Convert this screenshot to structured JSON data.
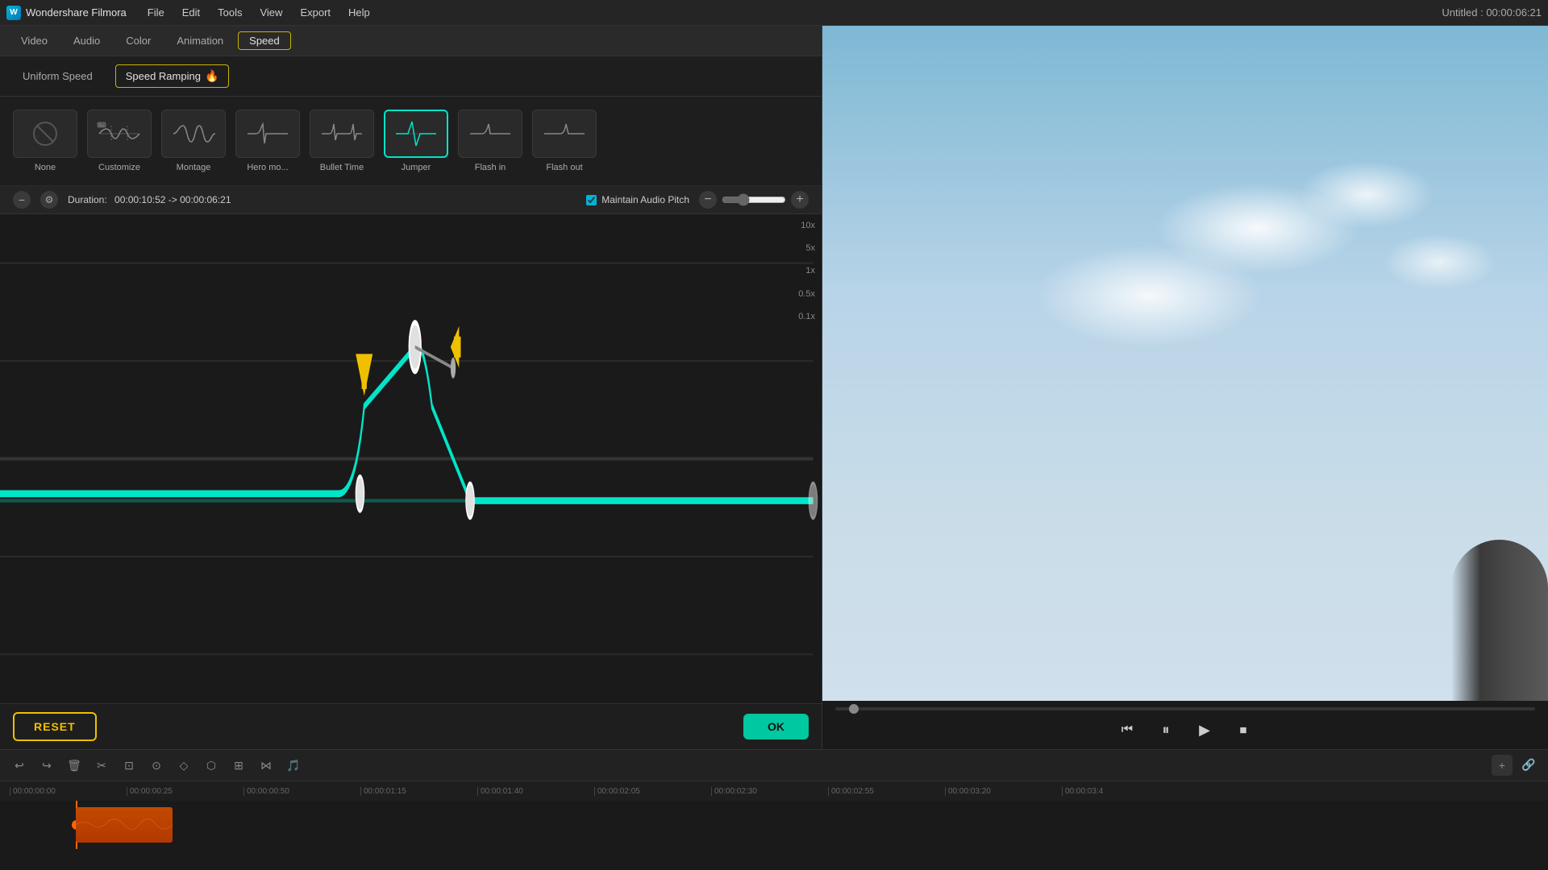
{
  "app": {
    "name": "Wondershare Filmora",
    "title": "Untitled : 00:00:06:21"
  },
  "menubar": {
    "items": [
      "File",
      "Edit",
      "Tools",
      "View",
      "Export",
      "Help"
    ]
  },
  "prop_tabs": {
    "items": [
      "Video",
      "Audio",
      "Color",
      "Animation",
      "Speed"
    ],
    "active": "Speed"
  },
  "speed_tabs": {
    "uniform": "Uniform Speed",
    "ramping": "Speed Ramping",
    "active": "Speed Ramping"
  },
  "presets": [
    {
      "id": "none",
      "label": "None",
      "selected": false
    },
    {
      "id": "customize",
      "label": "Customize",
      "selected": false
    },
    {
      "id": "montage",
      "label": "Montage",
      "selected": false
    },
    {
      "id": "hero-mo",
      "label": "Hero mo...",
      "selected": false
    },
    {
      "id": "bullet-time",
      "label": "Bullet Time",
      "selected": false
    },
    {
      "id": "jumper",
      "label": "Jumper",
      "selected": true
    },
    {
      "id": "flash-in",
      "label": "Flash in",
      "selected": false
    },
    {
      "id": "flash-out",
      "label": "Flash out",
      "selected": false
    }
  ],
  "duration": {
    "label": "Duration:",
    "value": "00:00:10:52 -> 00:00:06:21",
    "maintain_pitch_label": "Maintain Audio Pitch"
  },
  "graph": {
    "speed_labels": [
      "10x",
      "5x",
      "1x",
      "0.5x",
      "0.1x"
    ]
  },
  "buttons": {
    "reset": "RESET",
    "ok": "OK"
  },
  "timeline": {
    "markers": [
      "00:00:00:00",
      "00:00:00:25",
      "00:00:00:50",
      "00:00:01:15",
      "00:00:01:40",
      "00:00:02:05",
      "00:00:02:30",
      "00:00:02:55",
      "00:00:03:20",
      "00:00:03:4"
    ]
  }
}
